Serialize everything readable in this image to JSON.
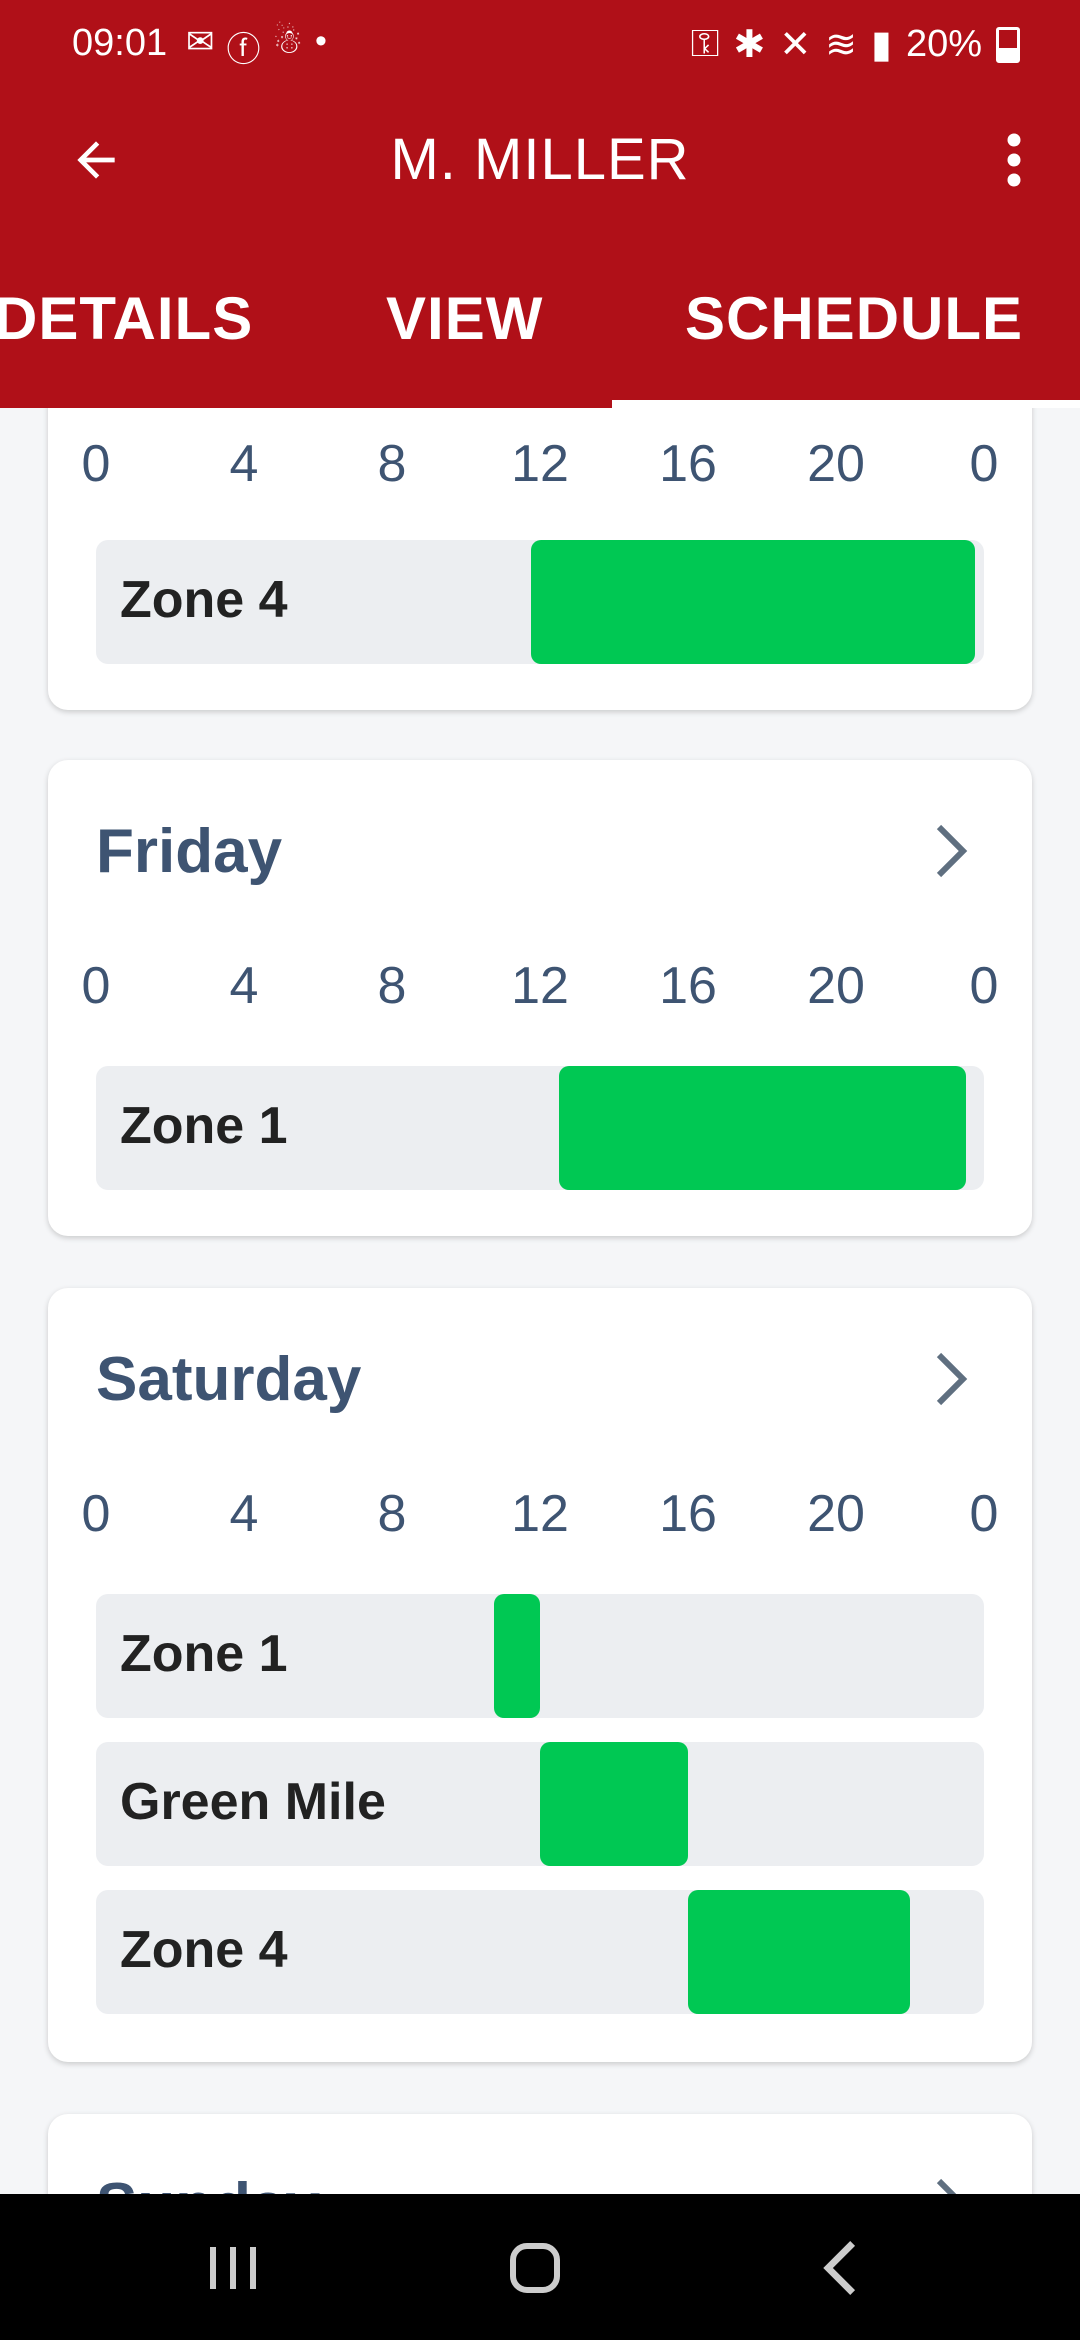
{
  "status_bar": {
    "time": "09:01",
    "left_icons": [
      "gmail-icon",
      "facebook-icon",
      "notification-icon",
      "dot-icon"
    ],
    "battery": "20%"
  },
  "app_bar": {
    "title": "M. MILLER",
    "back_icon": "arrow-left-icon",
    "more_icon": "more-vert-icon"
  },
  "tabs": [
    {
      "label": "DETAILS",
      "selected": false
    },
    {
      "label": "VIEW",
      "selected": false
    },
    {
      "label": "SCHEDULE",
      "selected": true
    }
  ],
  "axis_ticks": [
    "0",
    "4",
    "8",
    "12",
    "16",
    "20",
    "0"
  ],
  "days": [
    {
      "name": "",
      "zones": [
        {
          "label": "Zone 4",
          "start_hour": 11.75,
          "end_hour": 23.75
        }
      ]
    },
    {
      "name": "Friday",
      "zones": [
        {
          "label": "Zone 1",
          "start_hour": 12.5,
          "end_hour": 23.5
        }
      ]
    },
    {
      "name": "Saturday",
      "zones": [
        {
          "label": "Zone 1",
          "start_hour": 10.75,
          "end_hour": 12.0
        },
        {
          "label": "Green Mile",
          "start_hour": 12.0,
          "end_hour": 16.0
        },
        {
          "label": "Zone 4",
          "start_hour": 16.0,
          "end_hour": 22.0
        }
      ]
    },
    {
      "name": "Sunday",
      "zones": []
    }
  ],
  "colors": {
    "primary": "#b01018",
    "active_bar": "#00c853",
    "title_text": "#3e5472",
    "row_bg": "#eceef1"
  }
}
